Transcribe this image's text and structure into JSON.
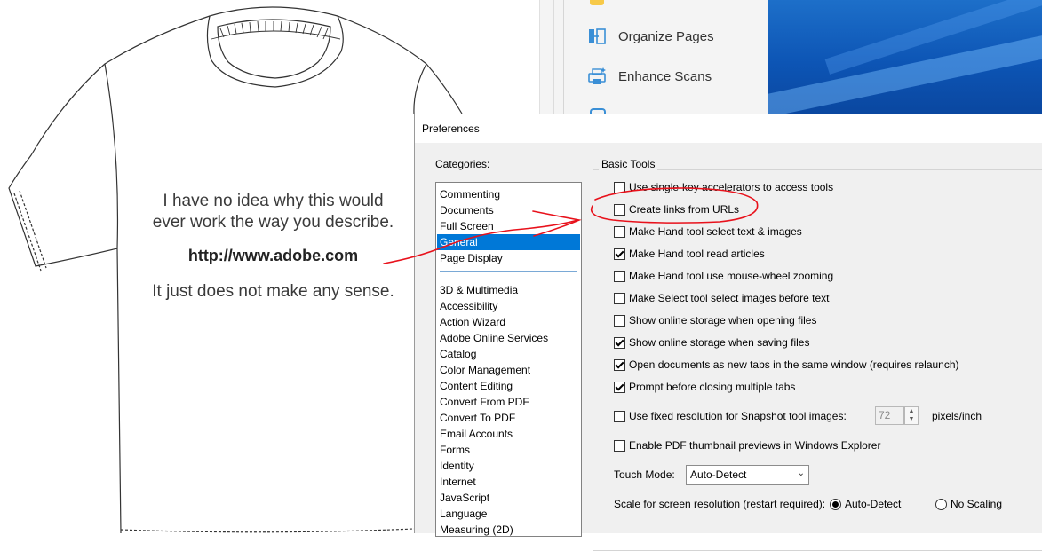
{
  "document": {
    "line1": "I have no idea why this would",
    "line2": "ever work the way you describe.",
    "url": "http://www.adobe.com",
    "line3": "It just does not make any sense."
  },
  "tools_pane": {
    "items": [
      {
        "label": "Organize Pages",
        "icon": "organize-pages-icon"
      },
      {
        "label": "Enhance Scans",
        "icon": "enhance-scans-icon"
      }
    ]
  },
  "dialog": {
    "title": "Preferences",
    "categories_label": "Categories:",
    "categories_top": [
      "Commenting",
      "Documents",
      "Full Screen",
      "General",
      "Page Display"
    ],
    "selected_category": "General",
    "categories_rest": [
      "3D & Multimedia",
      "Accessibility",
      "Action Wizard",
      "Adobe Online Services",
      "Catalog",
      "Color Management",
      "Content Editing",
      "Convert From PDF",
      "Convert To PDF",
      "Email Accounts",
      "Forms",
      "Identity",
      "Internet",
      "JavaScript",
      "Language",
      "Measuring (2D)"
    ],
    "group_title": "Basic Tools",
    "options": [
      {
        "label": "Use single-key accelerators to access tools",
        "checked": false
      },
      {
        "label": "Create links from URLs",
        "checked": false
      },
      {
        "label": "Make Hand tool select text & images",
        "checked": false
      },
      {
        "label": "Make Hand tool read articles",
        "checked": true
      },
      {
        "label": "Make Hand tool use mouse-wheel zooming",
        "checked": false
      },
      {
        "label": "Make Select tool select images before text",
        "checked": false
      },
      {
        "label": "Show online storage when opening files",
        "checked": false
      },
      {
        "label": "Show online storage when saving files",
        "checked": true
      },
      {
        "label": "Open documents as new tabs in the same window (requires relaunch)",
        "checked": true
      },
      {
        "label": "Prompt before closing multiple tabs",
        "checked": true
      }
    ],
    "snapshot": {
      "label": "Use fixed resolution for Snapshot tool images:",
      "checked": false,
      "value": "72",
      "unit": "pixels/inch"
    },
    "thumbnail": {
      "label": "Enable PDF thumbnail previews in Windows Explorer",
      "checked": false
    },
    "touch_mode": {
      "label": "Touch Mode:",
      "value": "Auto-Detect"
    },
    "scale": {
      "label": "Scale for screen resolution (restart required):",
      "option1": "Auto-Detect",
      "option2": "No Scaling",
      "selected": "Auto-Detect"
    }
  },
  "colors": {
    "selection": "#0078d7",
    "annotation": "#e8111b"
  }
}
